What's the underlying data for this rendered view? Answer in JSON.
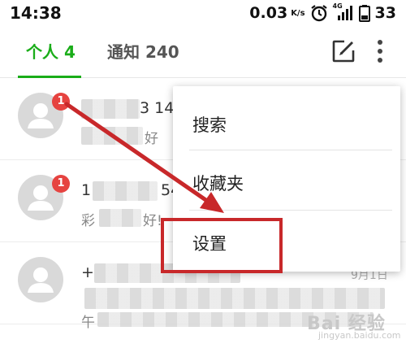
{
  "status_bar": {
    "time": "14:38",
    "net_speed": "0.03",
    "net_unit": "K/s",
    "network_type": "4G",
    "battery": "33"
  },
  "tabs": [
    {
      "label": "个人 4",
      "active": true
    },
    {
      "label": "通知 240",
      "active": false
    }
  ],
  "messages": [
    {
      "badge": "1",
      "title_fragment": "3 14",
      "sub_fragment": "好"
    },
    {
      "badge": "1",
      "title_fragment_start": "1",
      "title_fragment": "54",
      "sub_start": "彩",
      "sub_fragment": "好!"
    },
    {
      "title_fragment_start": "+",
      "date": "9月1日",
      "sub_start": "午"
    }
  ],
  "menu": {
    "items": [
      {
        "label": "搜索"
      },
      {
        "label": "收藏夹"
      },
      {
        "label": "设置"
      }
    ]
  },
  "watermark": {
    "main": "Bai 经验",
    "sub": "jingyan.baidu.com"
  },
  "colors": {
    "accent": "#1aad19",
    "badge": "#e64340",
    "annotation": "#c8282a"
  }
}
